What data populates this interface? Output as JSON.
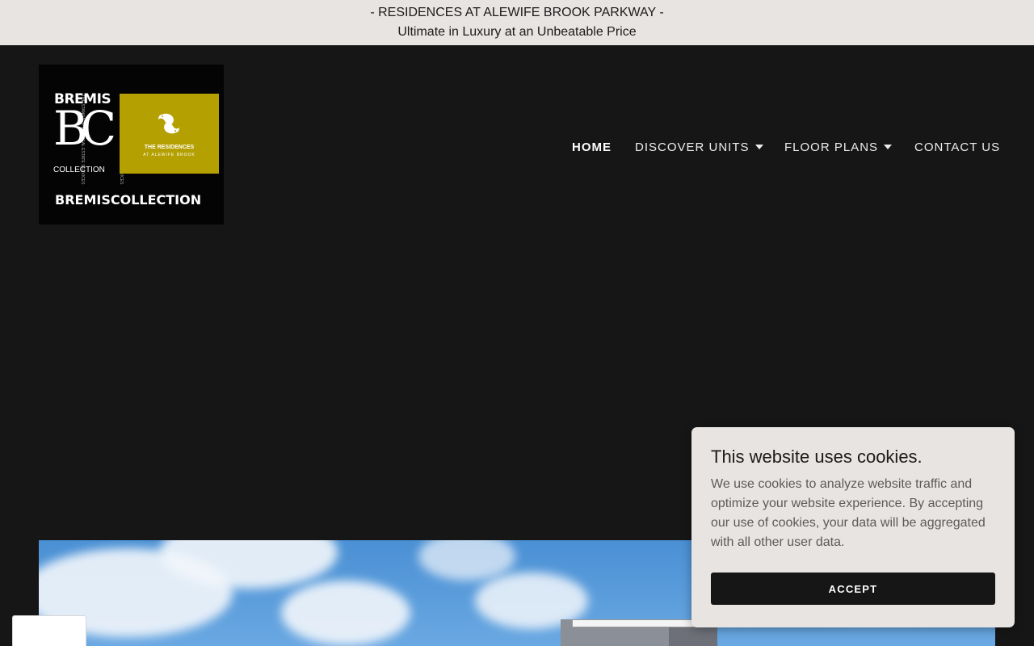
{
  "announcement": {
    "line1": "- RESIDENCES AT ALEWIFE BROOK PARKWAY -",
    "line2": "Ultimate in Luxury at an Unbeatable Price"
  },
  "logo": {
    "brand_word": "BREMIS",
    "monogram": "BC",
    "collection_small": "COLLECTION",
    "tagline": "THE STANDARD FOR REAL ESTATE SERVICES",
    "residences_line1": "THE RESIDENCES",
    "residences_line2": "AT ALEWIFE BROOK",
    "bottom_part1": "BREMIS",
    "bottom_part2": "COLLECTION",
    "emblem_icon": "koi-fish-icon"
  },
  "nav": {
    "items": [
      {
        "label": "HOME",
        "active": true,
        "has_dropdown": false
      },
      {
        "label": "DISCOVER UNITS",
        "active": false,
        "has_dropdown": true
      },
      {
        "label": "FLOOR PLANS",
        "active": false,
        "has_dropdown": true
      },
      {
        "label": "CONTACT US",
        "active": false,
        "has_dropdown": false
      }
    ],
    "dropdown_icon": "caret-down-icon"
  },
  "cookie_banner": {
    "title": "This website uses cookies.",
    "body": "We use cookies to analyze website traffic and optimize your website experience. By accepting our use of cookies, your data will be aggregated with all other user data.",
    "accept_label": "ACCEPT"
  },
  "colors": {
    "page_background": "#161616",
    "announcement_background": "#e8e4e1",
    "logo_gold": "#b5a002",
    "cookie_background": "#e8e4e1",
    "button_background": "#161616"
  }
}
